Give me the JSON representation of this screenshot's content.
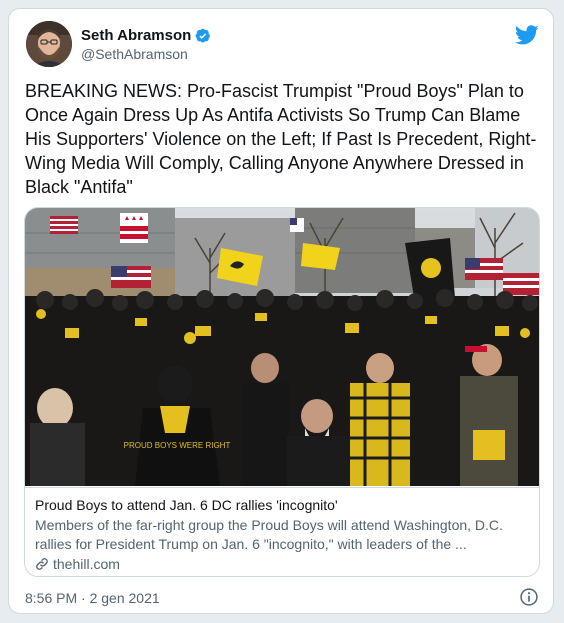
{
  "author": {
    "name": "Seth Abramson",
    "handle": "@SethAbramson"
  },
  "tweet": {
    "text": "BREAKING NEWS: Pro-Fascist Trumpist \"Proud Boys\" Plan to Once Again Dress Up As Antifa Activists So Trump Can Blame His Supporters' Violence on the Left; If Past Is Precedent, Right-Wing Media Will Comply, Calling Anyone Anywhere Dressed in Black \"Antifa\"",
    "timestamp": "8:56 PM · 2 gen 2021"
  },
  "link_card": {
    "title": "Proud Boys to attend Jan. 6 DC rallies 'incognito'",
    "description": "Members of the far-right group the Proud Boys will attend Washington, D.C. rallies for President Trump on Jan. 6 \"incognito,\" with leaders of the ...",
    "domain": "thehill.com",
    "photo_shirt_text": "PROUD BOYS WERE RIGHT"
  },
  "icons": {
    "verified": "verified-badge-icon",
    "brand": "twitter-bird-icon",
    "link": "link-icon",
    "info": "info-icon"
  },
  "colors": {
    "brand": "#1d9bf0",
    "text": "#0f1419",
    "secondary": "#536471",
    "border": "#cfd9de"
  }
}
